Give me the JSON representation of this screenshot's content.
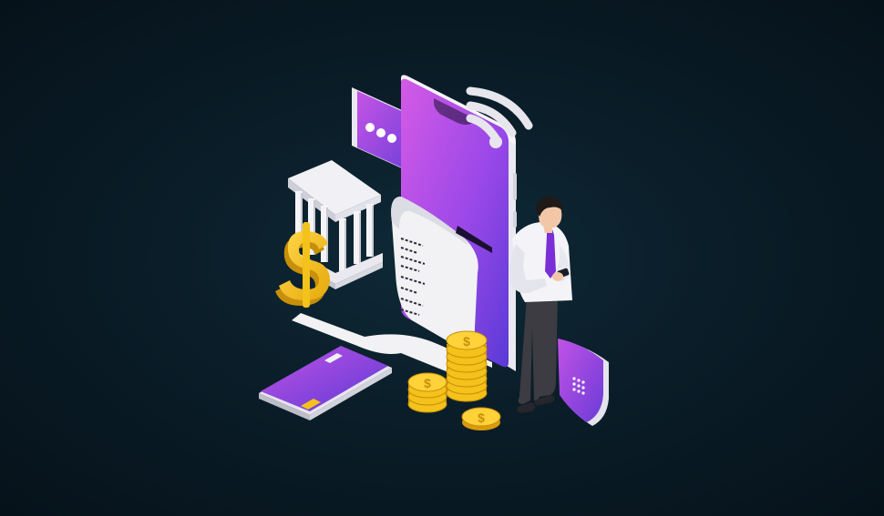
{
  "illustration": {
    "subject": "mobile-payment",
    "receipt": {
      "lines": [
        "",
        "",
        "",
        "",
        "",
        "",
        "",
        ""
      ]
    },
    "chat_bubble": {
      "icon": "ellipsis-icon"
    },
    "coins": {
      "icon": "dollar-icon"
    },
    "shield": {
      "icon": "keypad-icon"
    },
    "colors": {
      "background": "#081924",
      "phone_gradient_start": "#c252e8",
      "phone_gradient_end": "#5b3bd8",
      "coin_gold": "#f3c21b",
      "coin_shadow": "#c78f0a",
      "paper": "#f2f2f4",
      "tie": "#7a2fd6"
    }
  }
}
